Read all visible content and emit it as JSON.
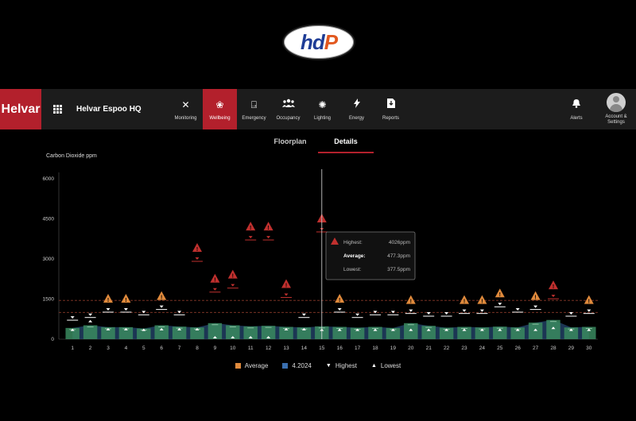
{
  "logo": {
    "hd": "hd",
    "p": "P"
  },
  "nav": {
    "brand": "Helvar",
    "site": "Helvar Espoo HQ",
    "items": [
      {
        "label": "Monitoring",
        "icon": "tools-icon",
        "glyph": "✕"
      },
      {
        "label": "Wellbeing",
        "icon": "lotus-icon",
        "glyph": "❀"
      },
      {
        "label": "Emergency",
        "icon": "exit-icon",
        "glyph": "⍈"
      },
      {
        "label": "Occupancy",
        "icon": "people-icon",
        "glyph": "👥"
      },
      {
        "label": "Lighting",
        "icon": "light-icon",
        "glyph": "✺"
      },
      {
        "label": "Energy",
        "icon": "bolt-icon",
        "glyph": "⚡"
      },
      {
        "label": "Reports",
        "icon": "report-icon",
        "glyph": "⬇"
      }
    ],
    "alerts": "Alerts",
    "account": "Account & Settings"
  },
  "tabs": {
    "floorplan": "Floorplan",
    "details": "Details"
  },
  "metric_title": "Carbon Dioxide ppm",
  "tooltip": {
    "highest_label": "Highest:",
    "highest_value": "4026ppm",
    "average_label": "Average:",
    "average_value": "477.3ppm",
    "lowest_label": "Lowest:",
    "lowest_value": "377.5ppm"
  },
  "legend": {
    "average": "Average",
    "month": "4.2024",
    "highest": "Highest",
    "lowest": "Lowest"
  },
  "colors": {
    "brand": "#b3202c",
    "bar": "#3a8a5f",
    "area": "#2e5a8c",
    "warn": "#e08a3c",
    "alarm": "#c0302e"
  },
  "chart_data": {
    "type": "bar",
    "title": "Carbon Dioxide ppm",
    "ylim": [
      0,
      6000
    ],
    "yticks": [
      0,
      1500,
      3000,
      4500,
      6000
    ],
    "ytick_labels": [
      "0",
      "1500",
      "3000",
      "4500",
      "6000"
    ],
    "threshold_lines": [
      1450,
      1000
    ],
    "categories": [
      "1",
      "2",
      "3",
      "4",
      "5",
      "6",
      "7",
      "8",
      "9",
      "10",
      "11",
      "12",
      "13",
      "14",
      "15",
      "16",
      "17",
      "18",
      "19",
      "20",
      "21",
      "22",
      "23",
      "24",
      "25",
      "26",
      "27",
      "28",
      "29",
      "30"
    ],
    "series": [
      {
        "name": "Average",
        "values": [
          420,
          520,
          450,
          450,
          400,
          520,
          470,
          440,
          600,
          520,
          480,
          500,
          460,
          440,
          480,
          460,
          430,
          460,
          420,
          600,
          500,
          430,
          460,
          440,
          470,
          440,
          620,
          720,
          440,
          460
        ]
      },
      {
        "name": "Highest",
        "values": [
          800,
          900,
          1100,
          1100,
          1000,
          1200,
          1000,
          3000,
          1850,
          2000,
          3800,
          3800,
          1650,
          900,
          4100,
          1100,
          900,
          1000,
          1000,
          1050,
          950,
          950,
          1050,
          1050,
          1300,
          1100,
          1200,
          1600,
          950,
          1050
        ]
      },
      {
        "name": "Lowest",
        "values": [
          280,
          600,
          300,
          300,
          280,
          300,
          300,
          300,
          0,
          0,
          0,
          0,
          300,
          300,
          280,
          280,
          280,
          280,
          280,
          280,
          280,
          280,
          280,
          280,
          280,
          280,
          280,
          350,
          280,
          280
        ]
      }
    ],
    "alerts": [
      {
        "day": 3,
        "level": "warn"
      },
      {
        "day": 4,
        "level": "warn"
      },
      {
        "day": 6,
        "level": "warn"
      },
      {
        "day": 8,
        "level": "alarm"
      },
      {
        "day": 9,
        "level": "alarm"
      },
      {
        "day": 10,
        "level": "alarm"
      },
      {
        "day": 11,
        "level": "alarm"
      },
      {
        "day": 12,
        "level": "alarm"
      },
      {
        "day": 13,
        "level": "alarm"
      },
      {
        "day": 15,
        "level": "alarm"
      },
      {
        "day": 16,
        "level": "warn"
      },
      {
        "day": 20,
        "level": "warn"
      },
      {
        "day": 23,
        "level": "warn"
      },
      {
        "day": 24,
        "level": "warn"
      },
      {
        "day": 25,
        "level": "warn"
      },
      {
        "day": 27,
        "level": "warn"
      },
      {
        "day": 28,
        "level": "alarm"
      },
      {
        "day": 30,
        "level": "warn"
      }
    ],
    "selected_day": 15
  }
}
